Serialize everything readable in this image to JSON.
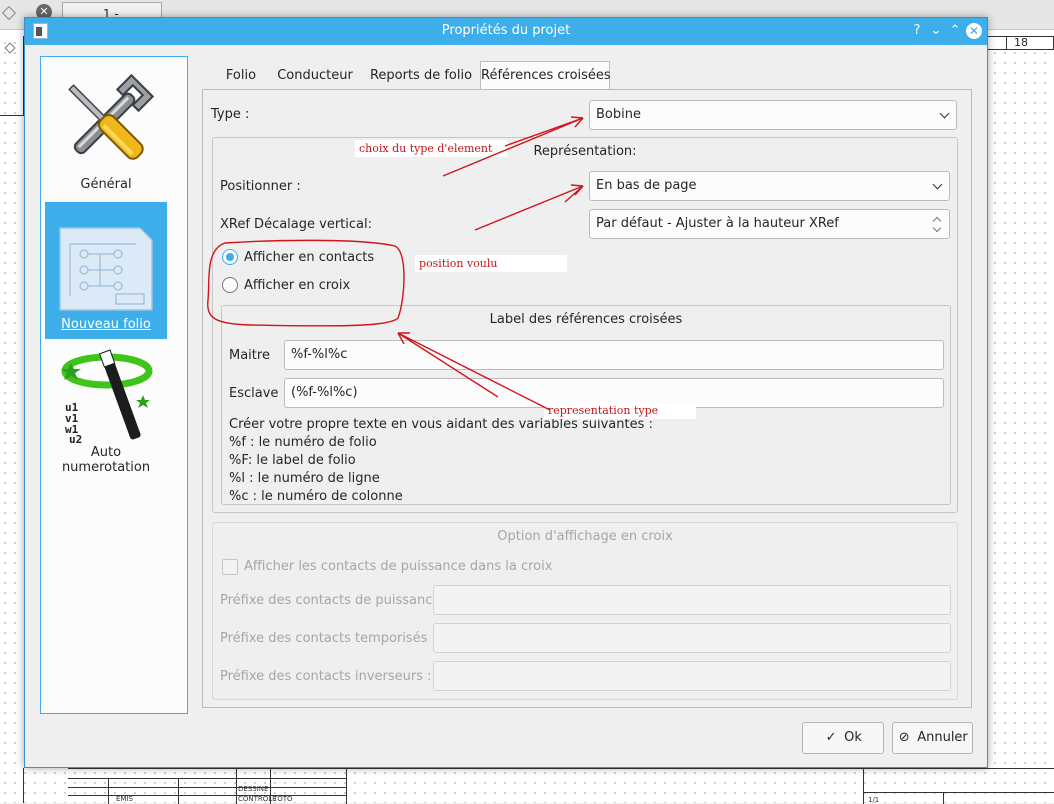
{
  "background": {
    "tab_label": "1 -",
    "ruler_number": "18",
    "cartouche": {
      "emis": "EMIS",
      "dessine": "DESSINE",
      "controle": "CONTROLE",
      "toto": "TOTO",
      "page": "1/1"
    }
  },
  "dialog": {
    "title": "Propriétés du projet",
    "help_glyph": "?",
    "minimize_glyph": "⌄",
    "maximize_glyph": "⌃",
    "close_glyph": "✕"
  },
  "sidebar": {
    "items": [
      {
        "label": "Général",
        "icon": "tools-icon"
      },
      {
        "label": "Nouveau folio",
        "icon": "folio-icon"
      },
      {
        "label": "Auto numerotation",
        "icon": "magic-wand-icon"
      }
    ]
  },
  "tabs": [
    "Folio",
    "Conducteur",
    "Reports de folio",
    "Références croisées"
  ],
  "xref": {
    "type_label": "Type :",
    "type_value": "Bobine",
    "representation_title": "Représentation:",
    "position_label": "Positionner :",
    "position_value": "En bas de page",
    "offset_label": "XRef Décalage vertical:",
    "offset_value": "Par défaut - Ajuster à la hauteur XRef",
    "radio_contacts": "Afficher en contacts",
    "radio_cross": "Afficher en croix",
    "label_group_title": "Label des références croisées",
    "master_label": "Maitre",
    "master_value": "%f-%l%c",
    "slave_label": "Esclave",
    "slave_value": "(%f-%l%c)",
    "help_lines": [
      "Créer votre propre texte en vous aidant des variables suivantes :",
      "%f : le numéro de folio",
      "%F: le label de folio",
      "%l : le numéro de ligne",
      "%c : le numéro de colonne"
    ],
    "cross_group_title": "Option d'affichage en croix",
    "power_checkbox": "Afficher les contacts de puissance dans la croix",
    "prefix_power": "Préfixe des contacts de puissance :",
    "prefix_timed": "Préfixe des contacts temporisés :",
    "prefix_inverter": "Préfixe des contacts inverseurs :"
  },
  "buttons": {
    "ok": "Ok",
    "cancel": "Annuler"
  },
  "annotations": {
    "type_note": "choix du type d'element",
    "position_note": "position voulu",
    "representation_note": "representation type"
  },
  "colors": {
    "accent": "#3daee9",
    "annotation": "#c1161a"
  }
}
